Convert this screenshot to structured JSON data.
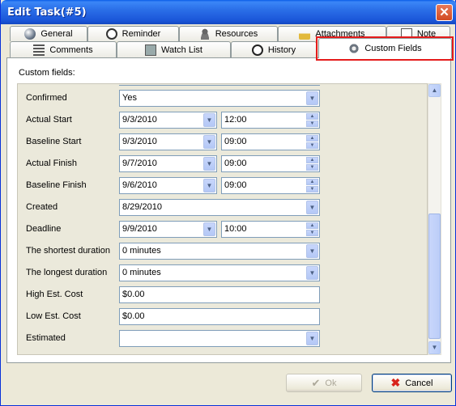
{
  "window": {
    "title": "Edit Task(#5)"
  },
  "tabs_row1": [
    {
      "label": "General",
      "icon": "globe-icon"
    },
    {
      "label": "Reminder",
      "icon": "alarm-clock-icon"
    },
    {
      "label": "Resources",
      "icon": "person-icon"
    },
    {
      "label": "Attachments",
      "icon": "padlock-icon"
    },
    {
      "label": "Note",
      "icon": "note-icon"
    }
  ],
  "tabs_row2": [
    {
      "label": "Comments",
      "icon": "comment-list-icon"
    },
    {
      "label": "Watch List",
      "icon": "watch-list-icon"
    },
    {
      "label": "History",
      "icon": "history-icon"
    },
    {
      "label": "Custom Fields",
      "icon": "gear-icon",
      "active": true
    }
  ],
  "panel": {
    "label": "Custom fields:"
  },
  "fields": {
    "confirmed": {
      "label": "Confirmed",
      "value": "Yes"
    },
    "actual_start": {
      "label": "Actual Start",
      "date": "9/3/2010",
      "time": "12:00"
    },
    "baseline_start": {
      "label": "Baseline Start",
      "date": "9/3/2010",
      "time": "09:00"
    },
    "actual_finish": {
      "label": "Actual Finish",
      "date": "9/7/2010",
      "time": "09:00"
    },
    "baseline_finish": {
      "label": "Baseline Finish",
      "date": "9/6/2010",
      "time": "09:00"
    },
    "created": {
      "label": "Created",
      "value": "8/29/2010"
    },
    "deadline": {
      "label": "Deadline",
      "date": "9/9/2010",
      "time": "10:00"
    },
    "shortest_duration": {
      "label": "The shortest duration",
      "value": "0 minutes"
    },
    "longest_duration": {
      "label": "The longest duration",
      "value": "0 minutes"
    },
    "high_cost": {
      "label": "High Est. Cost",
      "value": "$0.00"
    },
    "low_cost": {
      "label": "Low Est. Cost",
      "value": "$0.00"
    },
    "estimated": {
      "label": "Estimated",
      "value": ""
    }
  },
  "buttons": {
    "ok": "Ok",
    "cancel": "Cancel"
  },
  "colors": {
    "highlight": "#e51b1b",
    "titlebar": "#2b6fe8",
    "panel_bg": "#ebe9db"
  }
}
